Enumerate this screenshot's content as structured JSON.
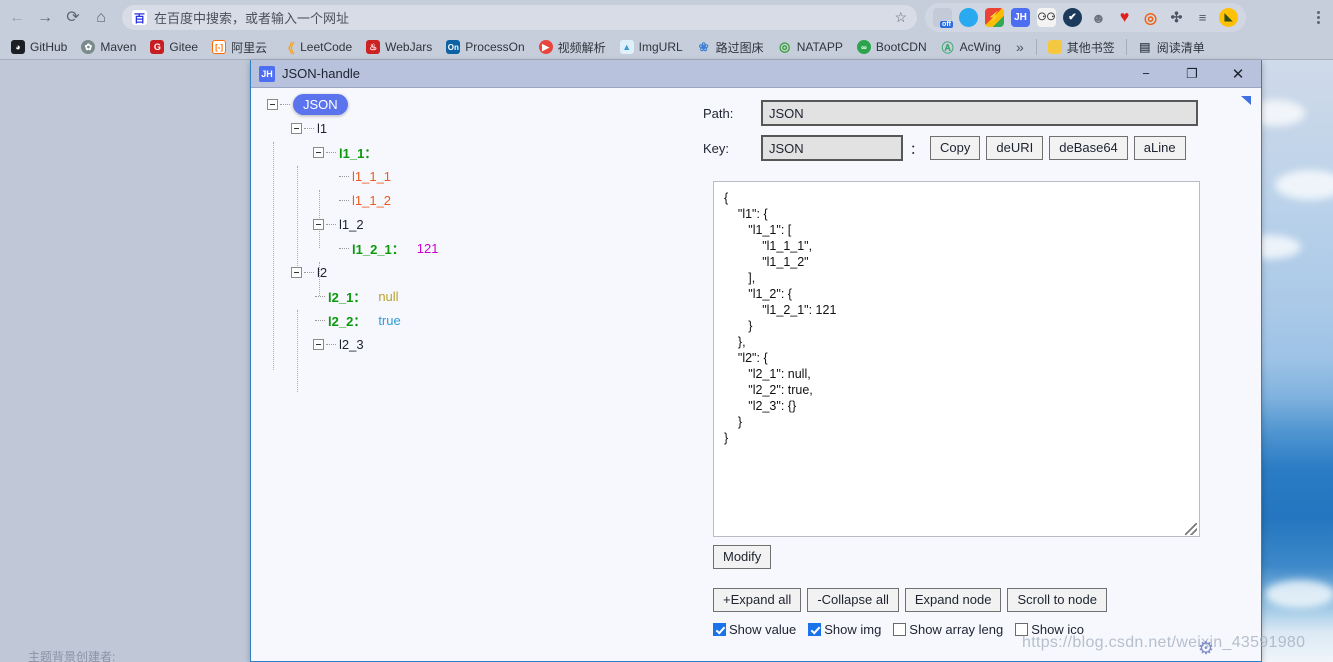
{
  "browser": {
    "nav": {
      "back": "←",
      "forward": "→",
      "reload": "⟳",
      "home": "⌂"
    },
    "omnibox": {
      "icon": "baidu-icon",
      "placeholder": "在百度中搜索，或者输入一个网址",
      "bookmark_star": "☆"
    },
    "extensions": [
      {
        "name": "proxy-switch-icon",
        "glyph": "off",
        "color": "#3b5bdb"
      },
      {
        "name": "blue-circle-icon",
        "glyph": "",
        "color": "#29a9f0"
      },
      {
        "name": "flash-icon",
        "glyph": "⚡",
        "color": "#e8ba12"
      },
      {
        "name": "json-handle-icon",
        "glyph": "JH",
        "color": "#4e6ef2"
      },
      {
        "name": "robot-icon",
        "glyph": "⚆",
        "color": "#f3f3f3"
      },
      {
        "name": "check-badge-icon",
        "glyph": "✔",
        "color": "#1b3a5c"
      },
      {
        "name": "palette-icon",
        "glyph": "☺",
        "color": "#cdd3de"
      },
      {
        "name": "heart-icon",
        "glyph": "♥",
        "color": "#e02020"
      },
      {
        "name": "spiral-icon",
        "glyph": "◎",
        "color": "#f06010"
      },
      {
        "name": "puzzle-icon",
        "glyph": "🧩",
        "color": "#5a6470"
      },
      {
        "name": "playlist-icon",
        "glyph": "≡♪",
        "color": "#5f6673"
      },
      {
        "name": "rice-ball-icon",
        "glyph": "◆",
        "color": "#ffc107"
      }
    ],
    "menu": "kebab-menu-icon",
    "bookmarks": [
      {
        "label": "GitHub",
        "icon": "github-icon",
        "color": "#1b1f23",
        "glyph": ""
      },
      {
        "label": "Maven",
        "icon": "maven-icon",
        "color": "#7b8a8b",
        "glyph": "✿"
      },
      {
        "label": "Gitee",
        "icon": "gitee-icon",
        "color": "#c71d23",
        "glyph": "G"
      },
      {
        "label": "阿里云",
        "icon": "aliyun-icon",
        "color": "#ff6a00",
        "glyph": "[-]"
      },
      {
        "label": "LeetCode",
        "icon": "leetcode-icon",
        "color": "#ffa116",
        "glyph": "《"
      },
      {
        "label": "WebJars",
        "icon": "webjars-icon",
        "color": "#cc2222",
        "glyph": "♨"
      },
      {
        "label": "ProcessOn",
        "icon": "processon-icon",
        "color": "#0b63a3",
        "glyph": "On"
      },
      {
        "label": "视频解析",
        "icon": "video-parse-icon",
        "color": "#e8453c",
        "glyph": "▶"
      },
      {
        "label": "ImgURL",
        "icon": "imgurl-icon",
        "color": "#3c9ad6",
        "glyph": "▲"
      },
      {
        "label": "路过图床",
        "icon": "luguo-imgbed-icon",
        "color": "#3d7fd4",
        "glyph": "●"
      },
      {
        "label": "NATAPP",
        "icon": "natapp-icon",
        "color": "#3aa03a",
        "glyph": "◎"
      },
      {
        "label": "BootCDN",
        "icon": "bootcdn-icon",
        "color": "#2ba44b",
        "glyph": "∞"
      },
      {
        "label": "AcWing",
        "icon": "acwing-icon",
        "color": "#39a56b",
        "glyph": "A"
      }
    ],
    "bookmarks_overflow": "»",
    "other_bookmarks": {
      "label": "其他书签",
      "icon": "folder-icon",
      "glyph": "▮"
    },
    "reading_list": {
      "label": "阅读清单",
      "icon": "reading-list-icon",
      "glyph": "▤"
    }
  },
  "desktop": {
    "theme_credit": "主题背景创建者:",
    "watermark": "https://blog.csdn.net/weixin_43591980"
  },
  "window": {
    "title": "JSON-handle",
    "icon_glyph": "JH",
    "minimize": "−",
    "maximize": "❐",
    "close": "✕"
  },
  "tree": {
    "root_badge": "JSON",
    "nodes": [
      {
        "label": "l1",
        "type": "label"
      },
      {
        "label": "l1_1：",
        "type": "key"
      },
      {
        "label": "l1_1_1",
        "type": "string"
      },
      {
        "label": "l1_1_2",
        "type": "string"
      },
      {
        "label": "l1_2",
        "type": "label"
      },
      {
        "label": "l1_2_1：",
        "type": "key",
        "value": "121",
        "value_type": "number"
      },
      {
        "label": "l2",
        "type": "label"
      },
      {
        "label": "l2_1：",
        "type": "key",
        "value": "null",
        "value_type": "null"
      },
      {
        "label": "l2_2：",
        "type": "key",
        "value": "true",
        "value_type": "bool"
      },
      {
        "label": "l2_3",
        "type": "label"
      }
    ]
  },
  "panel": {
    "path_label": "Path:",
    "path_value": "JSON",
    "key_label": "Key:",
    "key_value": "JSON",
    "key_colon": "：",
    "buttons": {
      "copy": "Copy",
      "deuri": "deURI",
      "debase64": "deBase64",
      "aline": "aLine",
      "modify": "Modify",
      "expand_all": "+Expand all",
      "collapse_all": "-Collapse all",
      "expand_node": "Expand node",
      "scroll_to_node": "Scroll to node"
    },
    "json_text": "{\n    \"l1\": {\n       \"l1_1\": [\n           \"l1_1_1\",\n           \"l1_1_2\"\n       ],\n       \"l1_2\": {\n           \"l1_2_1\": 121\n       }\n    },\n    \"l2\": {\n       \"l2_1\": null,\n       \"l2_2\": true,\n       \"l2_3\": {}\n    }\n}",
    "checkboxes": [
      {
        "label": "Show value",
        "checked": true
      },
      {
        "label": "Show img",
        "checked": true
      },
      {
        "label": "Show array leng",
        "checked": false
      },
      {
        "label": "Show ico",
        "checked": false
      }
    ]
  },
  "colors": {
    "accent": "#5b74ee",
    "key": "#0a9a0a",
    "string": "#ee5a22",
    "number": "#cc00cc",
    "null": "#b8a32e",
    "bool": "#2f9cd6",
    "window_border": "#2f7fc4",
    "titlebar": "#b9c2dd"
  }
}
